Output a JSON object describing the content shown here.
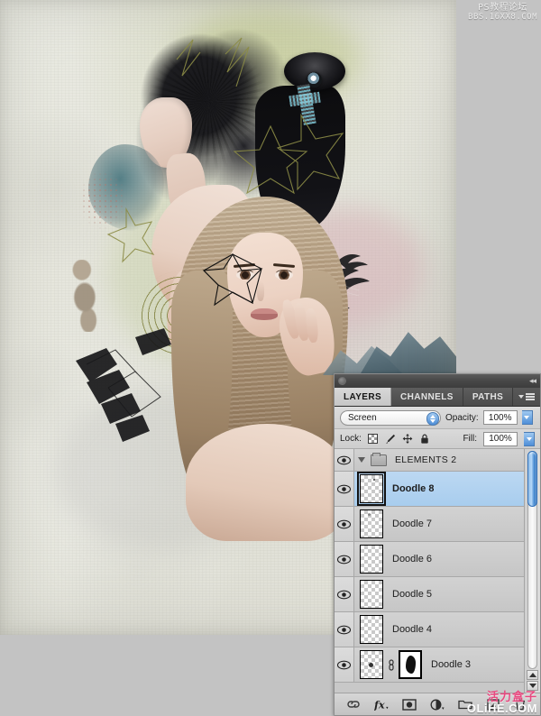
{
  "artwork": {
    "alt": "digital fashion photo-manipulation collage of two female models with doodle line-art, UFO, birds and mountains on textured paper background"
  },
  "watermarks": {
    "top": {
      "line1": "PS教程论坛",
      "line2": "BBS.16XX8.COM"
    },
    "bottom": {
      "cn": "活力盒子",
      "en": "OLiHE.COM",
      "cn_color": "#e8487f"
    }
  },
  "panel": {
    "titlebar": {
      "collapse_icon": "double-left-arrows"
    },
    "tabs": [
      {
        "label": "LAYERS",
        "active": true
      },
      {
        "label": "CHANNELS",
        "active": false
      },
      {
        "label": "PATHS",
        "active": false
      }
    ],
    "menu_icon": "panel-menu-icon",
    "blend_row": {
      "blend_mode": "Screen",
      "opacity_label": "Opacity:",
      "opacity_value": "100%"
    },
    "lock_row": {
      "lock_label": "Lock:",
      "lock_icons": [
        "transparency-checker-icon",
        "brush-icon",
        "move-icon",
        "lock-icon"
      ],
      "fill_label": "Fill:",
      "fill_value": "100%"
    },
    "layers": [
      {
        "name": "ELEMENTS 2",
        "type": "group",
        "visible": true,
        "expanded": true,
        "selected": false,
        "has_mask": false,
        "linked": false
      },
      {
        "name": "Doodle 8",
        "type": "layer",
        "visible": true,
        "expanded": false,
        "selected": true,
        "has_mask": false,
        "linked": false
      },
      {
        "name": "Doodle 7",
        "type": "layer",
        "visible": true,
        "expanded": false,
        "selected": false,
        "has_mask": false,
        "linked": false
      },
      {
        "name": "Doodle 6",
        "type": "layer",
        "visible": true,
        "expanded": false,
        "selected": false,
        "has_mask": false,
        "linked": false
      },
      {
        "name": "Doodle 5",
        "type": "layer",
        "visible": true,
        "expanded": false,
        "selected": false,
        "has_mask": false,
        "linked": false
      },
      {
        "name": "Doodle 4",
        "type": "layer",
        "visible": true,
        "expanded": false,
        "selected": false,
        "has_mask": false,
        "linked": false
      },
      {
        "name": "Doodle 3",
        "type": "layer",
        "visible": true,
        "expanded": false,
        "selected": false,
        "has_mask": true,
        "linked": true
      }
    ],
    "scrollbar": {
      "thumb_position": "top",
      "accent_color": "#4b8fd4"
    },
    "footer_buttons": [
      "link-layers-icon",
      "layer-style-fx-icon",
      "add-layer-mask-icon",
      "new-adjustment-layer-icon",
      "new-group-icon",
      "new-layer-icon",
      "delete-layer-icon"
    ]
  },
  "colors": {
    "panel_bg": "#d4d4d4",
    "titlebar": "#474747",
    "selected_row": "#a8cdee",
    "desktop_bg": "#c3c3c3"
  }
}
